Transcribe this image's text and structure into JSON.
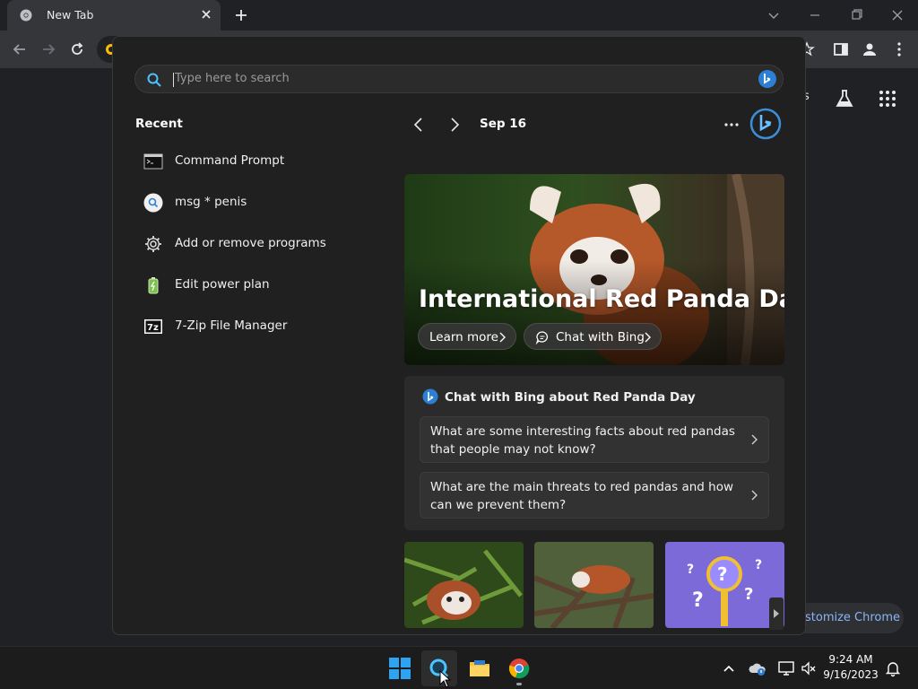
{
  "browser": {
    "tab_title": "New Tab",
    "ntp_partial_link": "es",
    "customize_label": "stomize Chrome"
  },
  "search": {
    "placeholder": "Type here to search"
  },
  "recent": {
    "title": "Recent",
    "items": [
      {
        "label": "Command Prompt",
        "icon": "cmd-icon"
      },
      {
        "label": "msg * penis",
        "icon": "search-result-icon"
      },
      {
        "label": "Add or remove programs",
        "icon": "gear-icon"
      },
      {
        "label": "Edit power plan",
        "icon": "battery-icon"
      },
      {
        "label": "7-Zip File Manager",
        "icon": "7zip-icon"
      }
    ]
  },
  "highlights": {
    "date": "Sep 16",
    "hero_title": "International Red Panda Day",
    "learn_more": "Learn more",
    "chat_with_bing": "Chat with Bing",
    "chat_card_title": "Chat with Bing about Red Panda Day",
    "suggestions": [
      "What are some interesting facts about red pandas that people may not know?",
      "What are the main threats to red pandas and how can we prevent them?"
    ]
  },
  "taskbar": {
    "time": "9:24 AM",
    "date": "9/16/2023"
  },
  "colors": {
    "accent_blue": "#8ab4f8",
    "panel_bg": "#202020",
    "bing_blue": "#3a8fd9"
  }
}
